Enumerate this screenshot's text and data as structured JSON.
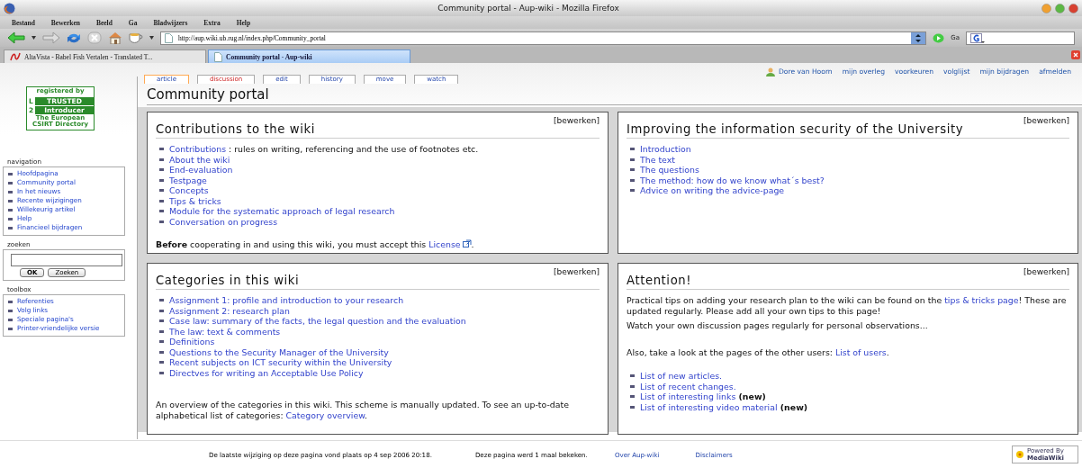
{
  "window": {
    "title": "Community portal - Aup-wiki - Mozilla Firefox"
  },
  "menu": [
    "Bestand",
    "Bewerken",
    "Beeld",
    "Ga",
    "Bladwijzers",
    "Extra",
    "Help"
  ],
  "toolbar": {
    "url": "http://aup.wiki.ub.rug.nl/index.php/Community_portal",
    "go_label": "Ga"
  },
  "browser_tabs": [
    {
      "label": "AltaVista - Babel Fish Vertalen - Translated T...",
      "selected": false
    },
    {
      "label": "Community portal - Aup-wiki",
      "selected": true
    }
  ],
  "user_links": [
    "Dore van Hoorn",
    "mijn overleg",
    "voorkeuren",
    "volglijst",
    "mijn bijdragen",
    "afmelden"
  ],
  "logo": {
    "lines": [
      "registered by",
      "TRUSTED",
      "Introducer",
      "The European",
      "CSIRT Directory"
    ],
    "badges": [
      "L",
      "2"
    ]
  },
  "sidebar": [
    {
      "kind": "links",
      "title": "navigation",
      "items": [
        "Hoofdpagina",
        "Community portal",
        "In het nieuws",
        "Recente wijzigingen",
        "Willekeurig artikel",
        "Help",
        "Financieel bijdragen"
      ]
    },
    {
      "kind": "search",
      "title": "zoeken",
      "buttons": [
        "OK",
        "Zoeken"
      ]
    },
    {
      "kind": "links",
      "title": "toolbox",
      "items": [
        "Referenties",
        "Volg links",
        "Speciale pagina's",
        "Printer-vriendelijke versie"
      ]
    }
  ],
  "page_tabs": [
    {
      "label": "article",
      "selected": true,
      "missing": false
    },
    {
      "label": "discussion",
      "selected": false,
      "missing": true
    },
    {
      "label": "edit",
      "selected": false,
      "missing": false
    },
    {
      "label": "history",
      "selected": false,
      "missing": false
    },
    {
      "label": "move",
      "selected": false,
      "missing": false
    },
    {
      "label": "watch",
      "selected": false,
      "missing": false
    }
  ],
  "page_title": "Community portal",
  "boxes": [
    {
      "title": "Contributions to the wiki",
      "edit": "[bewerken]",
      "blocks": [
        {
          "kind": "list",
          "items": [
            [
              {
                "kind": "link",
                "text": "Contributions"
              },
              {
                "kind": "text",
                "text": " : rules on writing, referencing and the use of footnotes etc."
              }
            ],
            [
              {
                "kind": "link",
                "text": "About the wiki"
              }
            ],
            [
              {
                "kind": "link",
                "text": "End-evaluation"
              }
            ],
            [
              {
                "kind": "link",
                "text": "Testpage"
              }
            ],
            [
              {
                "kind": "link",
                "text": "Concepts"
              }
            ],
            [
              {
                "kind": "link",
                "text": "Tips & tricks"
              }
            ],
            [
              {
                "kind": "link",
                "text": "Module for the systematic approach of legal research"
              }
            ],
            [
              {
                "kind": "link",
                "text": "Conversation on progress"
              }
            ]
          ]
        },
        {
          "kind": "blank"
        },
        {
          "kind": "para",
          "parts": [
            {
              "kind": "bold",
              "text": "Before"
            },
            {
              "kind": "text",
              "text": " cooperating in and using this wiki, you must accept this "
            },
            {
              "kind": "link",
              "text": "License",
              "external": true
            },
            {
              "kind": "text",
              "text": "."
            }
          ]
        }
      ]
    },
    {
      "title": "Improving the information security of the University",
      "edit": "[bewerken]",
      "blocks": [
        {
          "kind": "list",
          "items": [
            [
              {
                "kind": "link",
                "text": "Introduction"
              }
            ],
            [
              {
                "kind": "link",
                "text": "The text"
              }
            ],
            [
              {
                "kind": "link",
                "text": "The questions"
              }
            ],
            [
              {
                "kind": "link",
                "text": "The method: how do we know what´s best?"
              }
            ],
            [
              {
                "kind": "link",
                "text": "Advice on writing the advice-page"
              }
            ]
          ]
        }
      ]
    },
    {
      "title": "Categories in this wiki",
      "edit": "[bewerken]",
      "blocks": [
        {
          "kind": "list",
          "items": [
            [
              {
                "kind": "link",
                "text": "Assignment 1: profile and introduction to your research"
              }
            ],
            [
              {
                "kind": "link",
                "text": "Assignment 2: research plan"
              }
            ],
            [
              {
                "kind": "link",
                "text": "Case law: summary of the facts, the legal question and the evaluation"
              }
            ],
            [
              {
                "kind": "link",
                "text": "The law: text & comments"
              }
            ],
            [
              {
                "kind": "link",
                "text": "Definitions"
              }
            ],
            [
              {
                "kind": "link",
                "text": "Questions to the Security Manager of the University"
              }
            ],
            [
              {
                "kind": "link",
                "text": "Recent subjects on ICT security within the University"
              }
            ],
            [
              {
                "kind": "link",
                "text": "Directves for writing an Acceptable Use Policy"
              }
            ]
          ]
        },
        {
          "kind": "blank"
        },
        {
          "kind": "blank"
        },
        {
          "kind": "para",
          "parts": [
            {
              "kind": "text",
              "text": "An overview of the categories in this wiki. This scheme is manually updated. To see an up-to-date alphabetical list of categories: "
            },
            {
              "kind": "link",
              "text": "Category overview"
            },
            {
              "kind": "text",
              "text": "."
            }
          ]
        }
      ]
    },
    {
      "title": "Attention!",
      "edit": "[bewerken]",
      "blocks": [
        {
          "kind": "para",
          "parts": [
            {
              "kind": "text",
              "text": "Practical tips on adding your research plan to the wiki can be found on the "
            },
            {
              "kind": "link",
              "text": "tips & tricks page"
            },
            {
              "kind": "text",
              "text": "! These are updated regularly. Please add all your own tips to this page!"
            }
          ]
        },
        {
          "kind": "para",
          "parts": [
            {
              "kind": "text",
              "text": "Watch your own discussion pages regularly for personal observations..."
            }
          ]
        },
        {
          "kind": "blank"
        },
        {
          "kind": "para",
          "parts": [
            {
              "kind": "text",
              "text": "Also, take a look at the pages of the other users: "
            },
            {
              "kind": "link",
              "text": "List of users"
            },
            {
              "kind": "text",
              "text": "."
            }
          ]
        },
        {
          "kind": "blank"
        },
        {
          "kind": "list",
          "items": [
            [
              {
                "kind": "link",
                "text": "List of new articles."
              }
            ],
            [
              {
                "kind": "link",
                "text": "List of recent changes."
              }
            ],
            [
              {
                "kind": "link",
                "text": "List of interesting links"
              },
              {
                "kind": "bold",
                "text": " (new)"
              }
            ],
            [
              {
                "kind": "link",
                "text": "List of interesting video material"
              },
              {
                "kind": "bold",
                "text": " (new)"
              }
            ]
          ]
        }
      ]
    }
  ],
  "footer": {
    "texts": [
      "De laatste wijziging op deze pagina vond plaats op 4 sep 2006 20:18.",
      "Deze pagina werd 1 maal bekeken."
    ],
    "links": [
      "Over Aup-wiki",
      "Disclaimers"
    ],
    "badge": [
      "Powered By",
      "MediaWiki"
    ]
  }
}
